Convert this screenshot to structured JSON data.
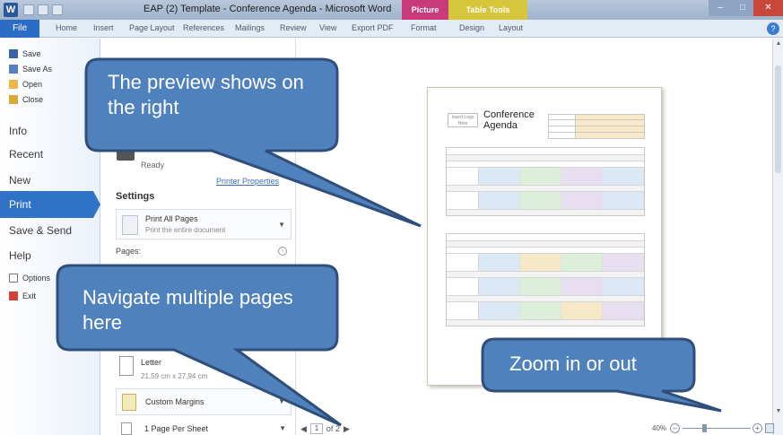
{
  "window": {
    "title": "EAP (2) Template - Conference Agenda - Microsoft Word",
    "context_tab_picture": "Picture Tools",
    "context_tab_table": "Table Tools"
  },
  "ribbon": {
    "file": "File",
    "tabs": [
      "Home",
      "Insert",
      "Page Layout",
      "References",
      "Mailings",
      "Review",
      "View",
      "Export PDF",
      "Format",
      "Design",
      "Layout"
    ]
  },
  "backstage_nav": {
    "save": "Save",
    "save_as": "Save As",
    "open": "Open",
    "close": "Close",
    "info": "Info",
    "recent": "Recent",
    "new": "New",
    "print": "Print",
    "save_send": "Save & Send",
    "help": "Help",
    "options": "Options",
    "exit": "Exit"
  },
  "print_panel": {
    "printer_status": "Ready",
    "printer_properties": "Printer Properties",
    "settings_heading": "Settings",
    "print_all_pages": "Print All Pages",
    "print_all_pages_desc": "Print the entire document",
    "pages_label": "Pages:",
    "paper_size": "Letter",
    "paper_size_desc": "21,59 cm x 27,94 cm",
    "margins": "Custom Margins",
    "pages_per_sheet": "1 Page Per Sheet"
  },
  "preview_doc": {
    "title": "Conference Agenda",
    "logo_text": "Insert Logo Here"
  },
  "statusbar": {
    "current_page": "1",
    "page_total": "of 2",
    "zoom": "40%"
  },
  "callouts": {
    "preview": "The preview shows on the right",
    "navigate": "Navigate multiple pages here",
    "zoom": "Zoom in or out"
  },
  "colors": {
    "callout_fill": "#4f81bd",
    "callout_stroke": "#2f4f7a",
    "nav_selected": "#2e73c6",
    "file_tab": "#2b6cc4",
    "picture_tools": "#c93a7a",
    "table_tools": "#d6c63c"
  }
}
